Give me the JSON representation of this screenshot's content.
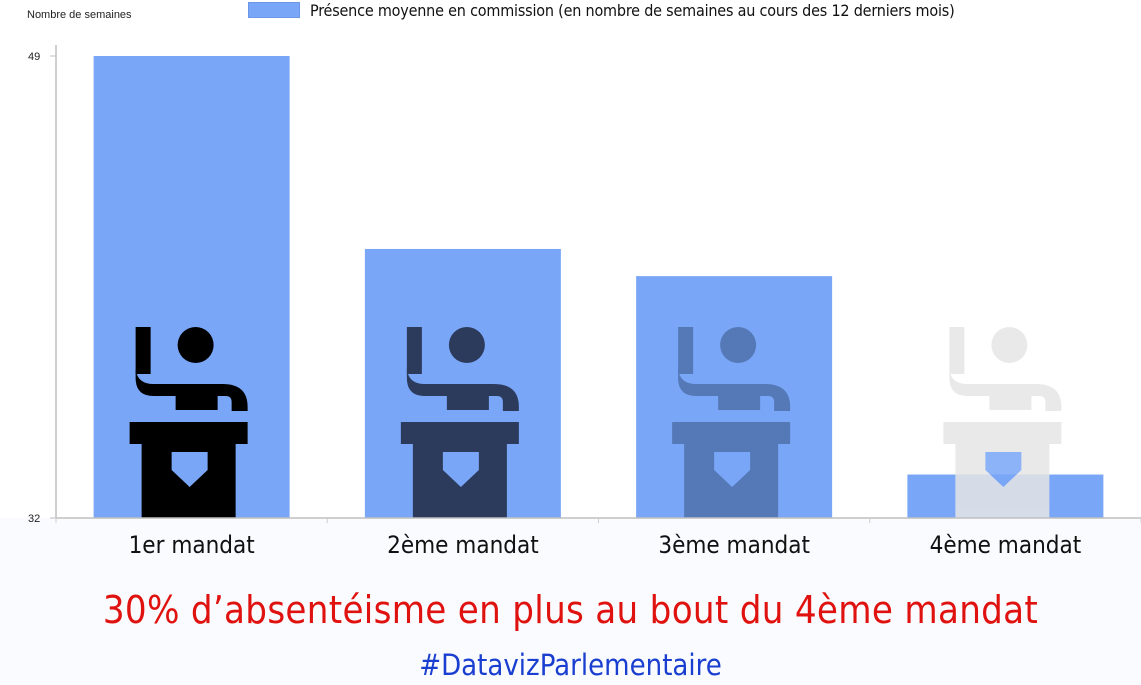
{
  "legend": {
    "label": "Présence moyenne en commission (en nombre de semaines au cours des 12 derniers mois)"
  },
  "footer": {
    "subtitle": "30% d’absentéisme en plus au bout du 4ème mandat",
    "hashtag": "#DatavizParlementaire"
  },
  "icon": {
    "name": "speaker-at-podium-icon"
  },
  "colors": {
    "bar": "#79a6f7",
    "subtitle": "#e0120f",
    "hashtag": "#1a3fd0",
    "icon_mandat_1": "#000000",
    "icon_mandat_2": "#2c3a5c",
    "icon_mandat_3": "#5578b6",
    "icon_mandat_4": "#e6e6e6"
  },
  "chart_data": {
    "type": "bar",
    "categories": [
      "1er mandat",
      "2ème mandat",
      "3ème mandat",
      "4ème mandat"
    ],
    "values": [
      49,
      41.9,
      40.9,
      33.6
    ],
    "series": [
      {
        "name": "Présence moyenne en commission (en nombre de semaines au cours des 12 derniers mois)",
        "values": [
          49,
          41.9,
          40.9,
          33.6
        ]
      }
    ],
    "ylabel": "Nombre de semaines",
    "xlabel": "",
    "ylim": [
      32,
      49
    ],
    "yticks": [
      "32",
      "49"
    ],
    "grid": false,
    "legend_position": "top"
  }
}
